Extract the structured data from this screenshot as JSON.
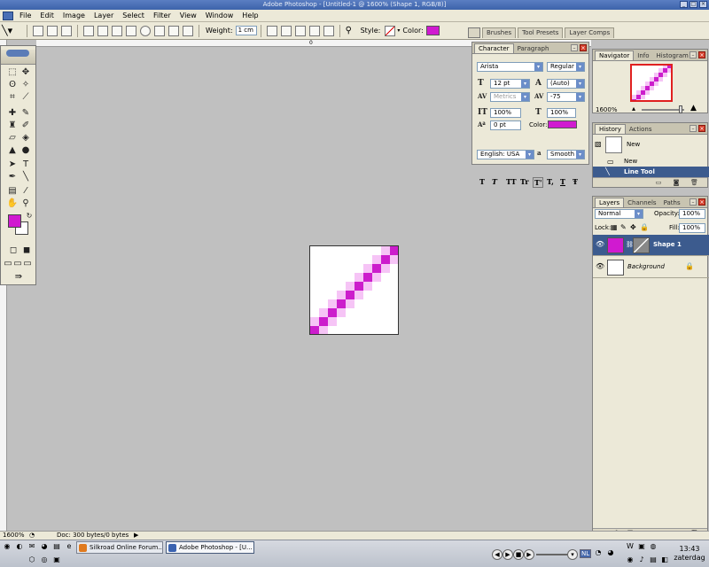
{
  "window": {
    "title": "Adobe Photoshop - [Untitled-1 @ 1600% (Shape 1, RGB/8)]"
  },
  "menu": [
    "File",
    "Edit",
    "Image",
    "Layer",
    "Select",
    "Filter",
    "View",
    "Window",
    "Help"
  ],
  "options": {
    "weight_label": "Weight:",
    "weight_value": "1 cm",
    "style_label": "Style:",
    "color_label": "Color:",
    "color": "#d01ad0"
  },
  "palette_well": [
    "Brushes",
    "Tool Presets",
    "Layer Comps"
  ],
  "ruler": {
    "top_tick": "0"
  },
  "colors": {
    "foreground": "#d01ad0",
    "background": "#ffffff",
    "pixel_dark": "#cc1dcc",
    "pixel_mid": "#e86ee8",
    "pixel_light": "#f6c4f6"
  },
  "character": {
    "tabs": [
      "Character",
      "Paragraph"
    ],
    "font": "Arista",
    "style": "Regular",
    "size": "12 pt",
    "leading": "(Auto)",
    "kerning": "Metrics",
    "tracking": "-75",
    "vscale": "100%",
    "hscale": "100%",
    "baseline": "0 pt",
    "color_label": "Color:",
    "language": "English: USA",
    "antialias_label": "a",
    "antialias": "Smooth",
    "format_buttons": [
      "T",
      "T",
      "TT",
      "Tr",
      "T'",
      "T,",
      "T",
      "Ŧ"
    ]
  },
  "navigator": {
    "tabs": [
      "Navigator",
      "Info",
      "Histogram"
    ],
    "zoom": "1600%"
  },
  "history": {
    "tabs": [
      "History",
      "Actions"
    ],
    "snapshot": "New",
    "items": [
      "New",
      "Line Tool"
    ]
  },
  "layers": {
    "tabs": [
      "Layers",
      "Channels",
      "Paths"
    ],
    "blend": "Normal",
    "opacity_label": "Opacity:",
    "opacity": "100%",
    "lock_label": "Lock:",
    "fill_label": "Fill:",
    "fill": "100%",
    "items": [
      {
        "name": "Shape 1"
      },
      {
        "name": "Background"
      }
    ]
  },
  "status": {
    "zoom": "1600%",
    "doc": "Doc: 300 bytes/0 bytes"
  },
  "taskbar": {
    "buttons": [
      "Silkroad Online Forum...",
      "Adobe Photoshop - [U..."
    ],
    "lang": "NL",
    "time": "13:43",
    "day": "zaterdag"
  }
}
